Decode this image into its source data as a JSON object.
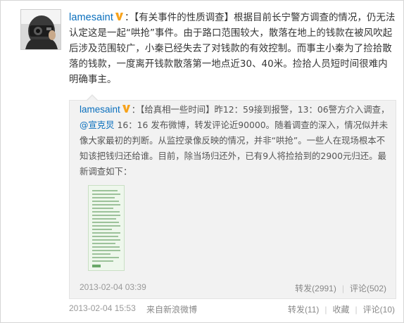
{
  "post": {
    "user": "lamesaint",
    "colon": "：",
    "text": "【有关事件的性质调查】根据目前长宁警方调查的情况，仍无法认定这是一起“哄抢”事件。由于路口范围较大，散落在地上的钱款在被风吹起后涉及范围较广，小秦已经失去了对钱款的有效控制。而事主小秦为了捡拾散落的钱款，一度离开钱款散落第一地点近30、40米。捡拾人员短时间很难内明确事主。",
    "timestamp": "2013-02-04 15:53",
    "source": "来自新浪微博",
    "actions": {
      "repost": "转发(11)",
      "favorite": "收藏",
      "comment": "评论(10)"
    }
  },
  "repost": {
    "user": "lamesaint",
    "colon": "：",
    "text_before_mention": "【给真相一些时间】昨12：59接到报警，13：06警方介入调查，",
    "mention": "@宣克炅",
    "text_after_mention": " 16：16 发布微博，转发评论近90000。随着调查的深入，情况似并未像大家最初的判断。从监控录像反映的情况，并非“哄抢”。一些人在现场根本不知该把钱归还给谁。目前，除当场归还外，已有9人将捡拾到的2900元归还。最新调查如下：",
    "timestamp": "2013-02-04 03:39",
    "actions": {
      "repost": "转发(2991)",
      "comment": "评论(502)"
    }
  },
  "icons": {
    "verified_badge": "verified-v-icon",
    "avatar": "photographer-avatar"
  },
  "colors": {
    "link": "#0a6fbd",
    "verified": "#f7a31c",
    "repost_bg": "#f2f2f2"
  }
}
